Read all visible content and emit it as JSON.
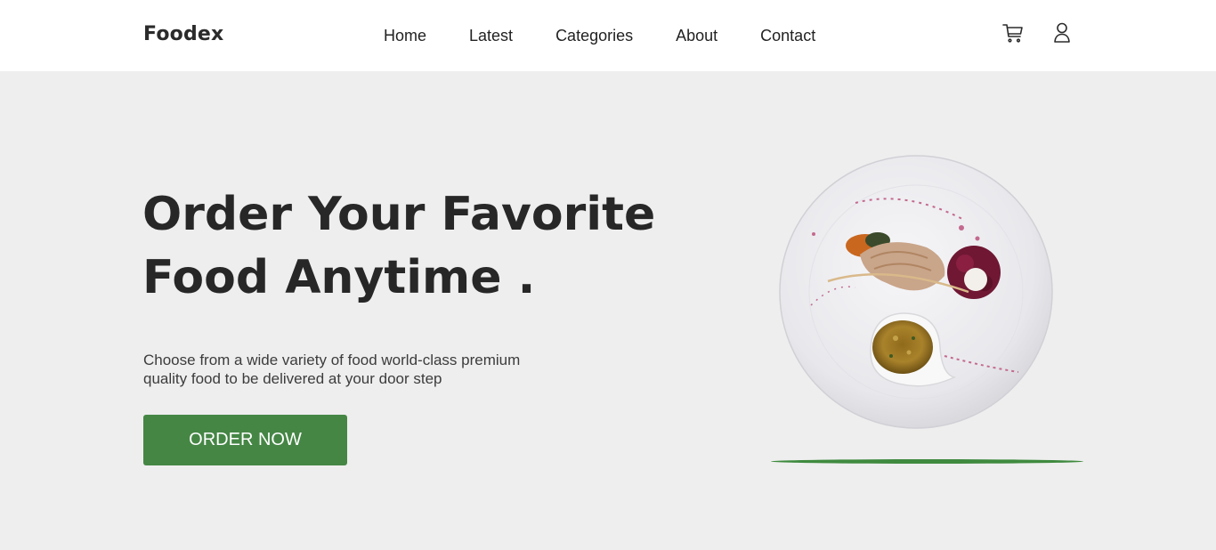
{
  "brand": {
    "name": "Foodex"
  },
  "nav": {
    "links": [
      {
        "label": "Home"
      },
      {
        "label": "Latest"
      },
      {
        "label": "Categories"
      },
      {
        "label": "About"
      },
      {
        "label": "Contact"
      }
    ],
    "icons": {
      "cart": "cart-icon",
      "user": "user-icon"
    }
  },
  "hero": {
    "headline_line1": "Order Your Favorite",
    "headline_line2": "Food Anytime .",
    "description": "Choose from a wide variety of food world-class premium quality food to be delivered at your door step",
    "cta_label": "ORDER NOW",
    "image_alt": "plated food dish"
  },
  "colors": {
    "accent": "#458645",
    "hero_bg": "#eeeeee",
    "text_dark": "#272727"
  }
}
